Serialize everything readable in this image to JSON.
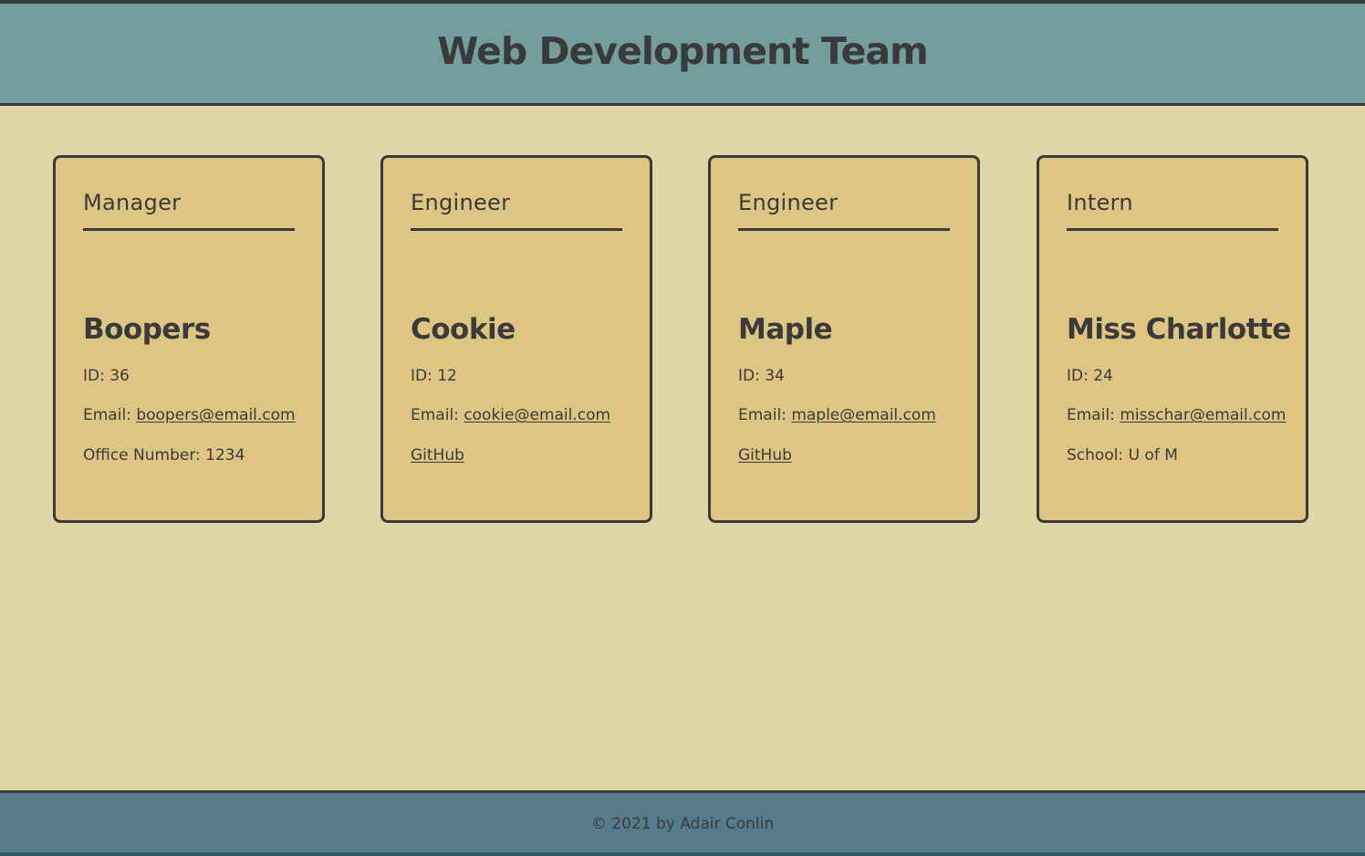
{
  "header": {
    "title": "Web Development Team"
  },
  "team": [
    {
      "role": "Manager",
      "name": "Boopers",
      "id_text": "ID: 36",
      "email_label": "Email:",
      "email": "boopers@email.com",
      "extra": "Office Number: 1234"
    },
    {
      "role": "Engineer",
      "name": "Cookie",
      "id_text": "ID: 12",
      "email_label": "Email:",
      "email": "cookie@email.com",
      "extra": "GitHub"
    },
    {
      "role": "Engineer",
      "name": "Maple",
      "id_text": "ID: 34",
      "email_label": "Email:",
      "email": "maple@email.com",
      "extra": "GitHub"
    },
    {
      "role": "Intern",
      "name": "Miss Charlotte",
      "id_text": "ID: 24",
      "email_label": "Email:",
      "email": "misschar@email.com",
      "extra": "School: U of M"
    }
  ],
  "footer": {
    "text": "© 2021 by Adair Conlin"
  },
  "colors": {
    "header_bg": "#729f9c",
    "page_bg": "#e0d7a8",
    "card_bg": "#dec584",
    "footer_bg": "#567b8a",
    "text": "#3a3a3a"
  }
}
